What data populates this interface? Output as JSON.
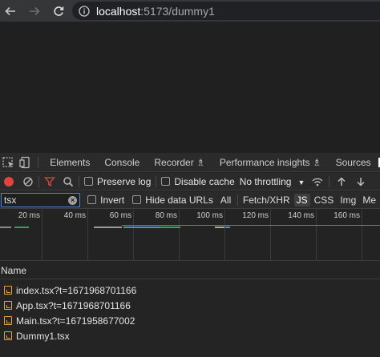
{
  "browser": {
    "url_host": "localhost",
    "url_path": ":5173/dummy1"
  },
  "devtools": {
    "tabs": [
      "Elements",
      "Console",
      "Recorder ♗",
      "Performance insights ♗",
      "Sources"
    ],
    "toolbar": {
      "preserve_log": "Preserve log",
      "disable_cache": "Disable cache",
      "throttling": "No throttling"
    },
    "filter": {
      "value": "tsx",
      "invert": "Invert",
      "hide_data_urls": "Hide data URLs",
      "types": [
        "All",
        "Fetch/XHR",
        "JS",
        "CSS",
        "Img",
        "Me"
      ],
      "active_type": "JS"
    },
    "timeline": {
      "ticks": [
        "20 ms",
        "40 ms",
        "60 ms",
        "80 ms",
        "100 ms",
        "120 ms",
        "140 ms",
        "160 ms"
      ]
    },
    "table": {
      "header": "Name",
      "rows": [
        "index.tsx?t=1671968701166",
        "App.tsx?t=1671968701166",
        "Main.tsx?t=1671958677002",
        "Dummy1.tsx"
      ]
    }
  },
  "colors": {
    "record_red": "#e0443e",
    "filter_active_red": "#e0443e",
    "focus_blue": "#4f7fd0",
    "file_icon_orange": "#e8a33a"
  }
}
